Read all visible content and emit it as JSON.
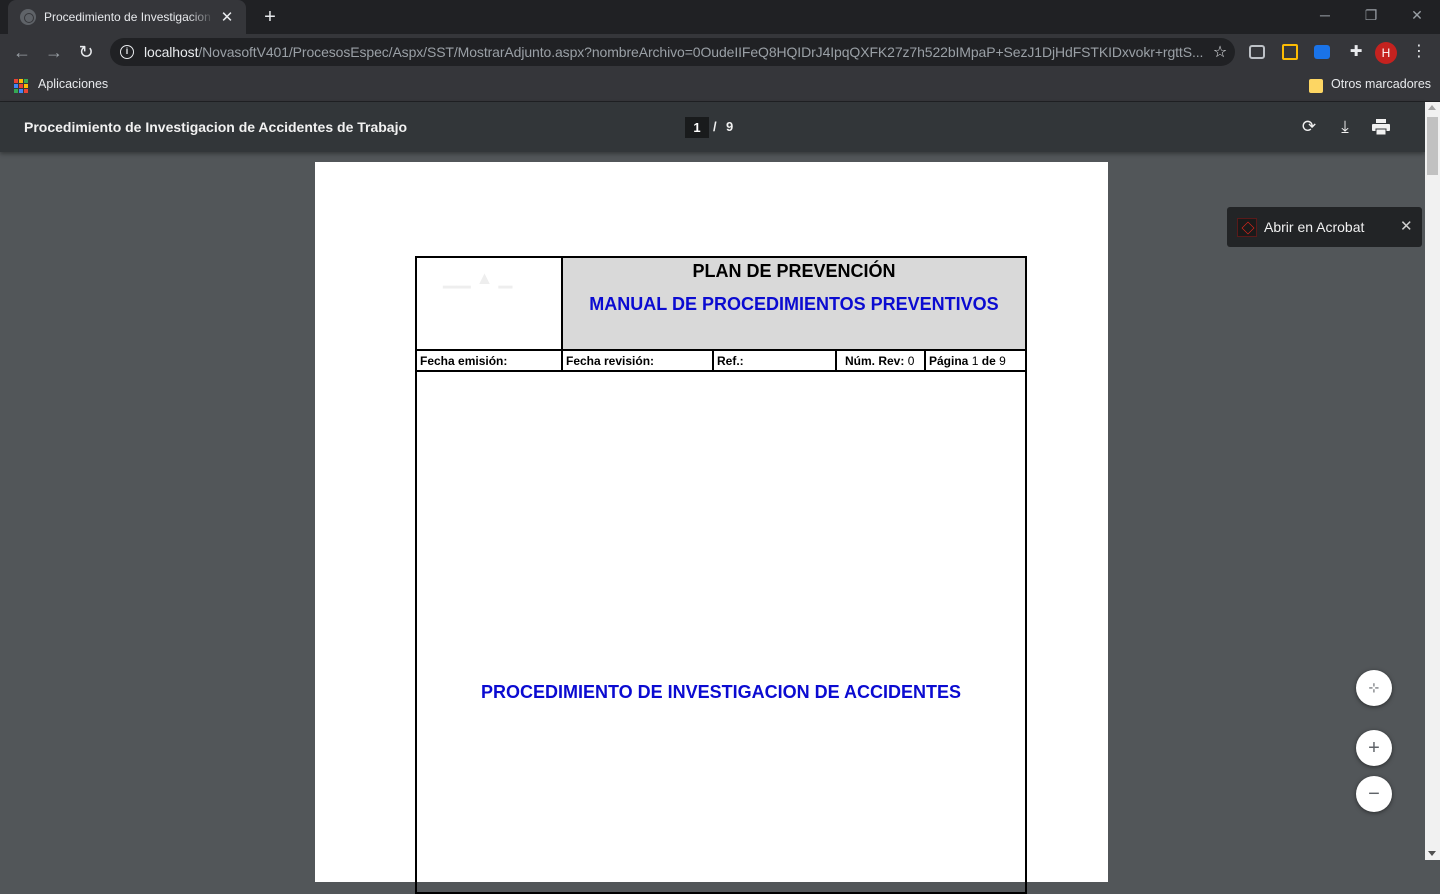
{
  "browser": {
    "tab_title": "Procedimiento de Investigacion de Accidentes de Trabajo",
    "url_host": "localhost",
    "url_path": "/NovasoftV401/ProcesosEspec/Aspx/SST/MostrarAdjunto.aspx?nombreArchivo=0OudeIIFeQ8HQIDrJ4IpqQXFK27z7h522bIMpaP+SezJ1DjHdFSTKIDxvokr+rgttS...",
    "avatar_initial": "H",
    "bookmarks": {
      "apps_label": "Aplicaciones",
      "other_label": "Otros marcadores"
    }
  },
  "pdf_viewer": {
    "title": "Procedimiento de Investigacion de Accidentes de Trabajo",
    "current_page": "1",
    "page_separator": "/",
    "total_pages": "9",
    "open_in_acrobat": "Abrir en Acrobat"
  },
  "document": {
    "plan_title": "PLAN DE PREVENCIÓN",
    "manual_title": "MANUAL DE PROCEDIMIENTOS PREVENTIVOS",
    "fecha_emision_label": "Fecha emisión:",
    "fecha_revision_label": "Fecha revisión:",
    "ref_label": "Ref.:",
    "num_rev_label": "Núm. Rev:",
    "num_rev_value": "0",
    "pagina_label": "Página",
    "pagina_value": "1",
    "pagina_de": "de",
    "pagina_total": "9",
    "procedure_title": "PROCEDIMIENTO DE INVESTIGACION DE ACCIDENTES"
  },
  "colors": {
    "doc_blue": "#0b0bd1",
    "header_gray": "#d9d9d9",
    "viewer_bg": "#525659",
    "acrobat_red": "#e3261c"
  },
  "icons": {
    "tab": [
      "globe-icon",
      "close-icon",
      "plus-icon"
    ],
    "toolbar": [
      "back-arrow-icon",
      "forward-arrow-icon",
      "reload-icon",
      "info-icon",
      "star-icon",
      "extension-icon",
      "menu-dots-icon"
    ],
    "pdf": [
      "rotate-icon",
      "download-icon",
      "print-icon",
      "fit-to-page-icon",
      "zoom-in-icon",
      "zoom-out-icon",
      "acrobat-icon"
    ]
  }
}
